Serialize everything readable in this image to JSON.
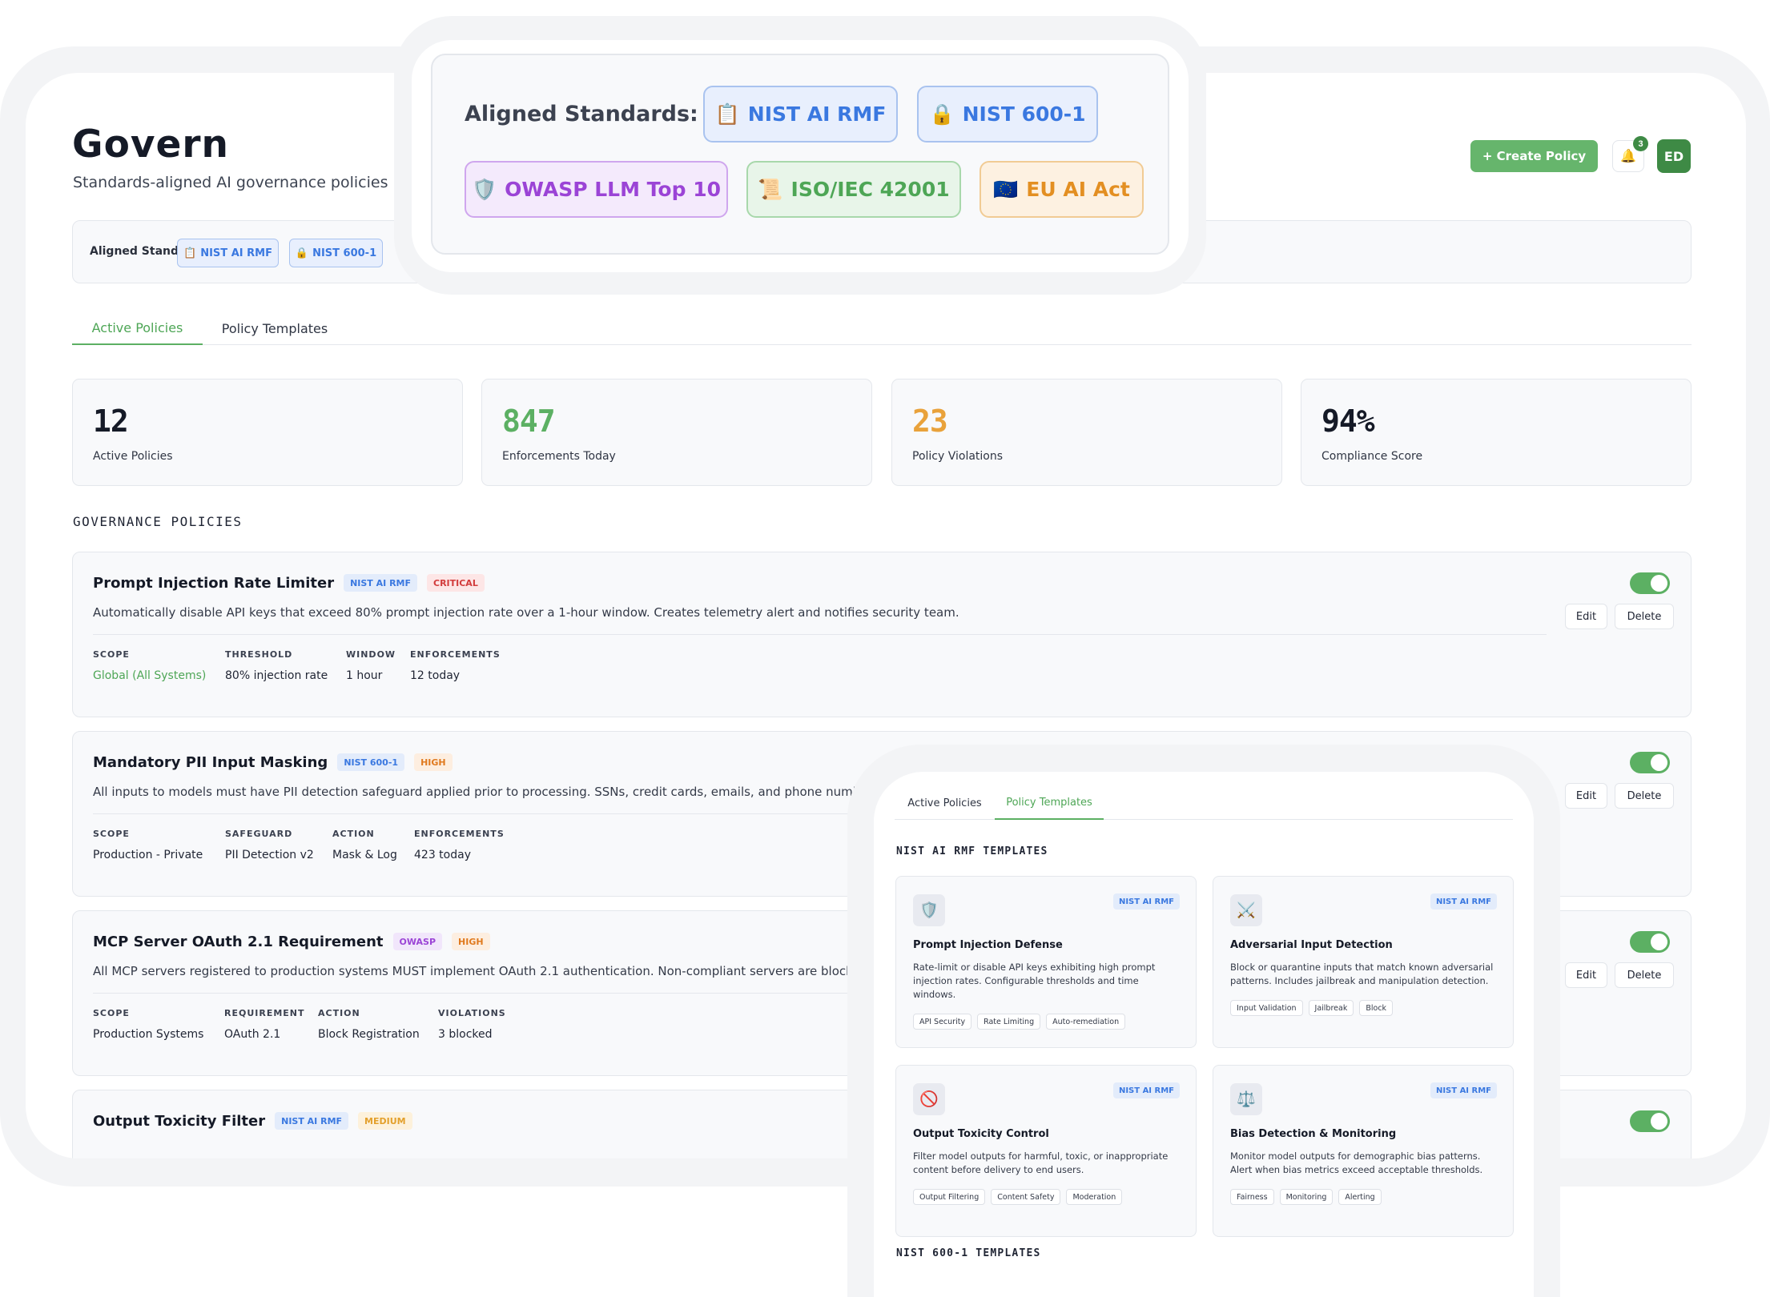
{
  "header": {
    "title": "Govern",
    "subtitle": "Standards-aligned AI governance policies",
    "create_label": "+ Create Policy",
    "notification_count": "3",
    "avatar_initials": "ED"
  },
  "standards": {
    "label": "Aligned Standards:",
    "items": [
      {
        "icon": "📋",
        "label": "NIST AI RMF"
      },
      {
        "icon": "🔒",
        "label": "NIST 600-1"
      },
      {
        "icon": "🛡️",
        "label": "OWASP LLM Top 10"
      },
      {
        "icon": "📜",
        "label": "ISO/IEC 42001"
      },
      {
        "icon": "🇪🇺",
        "label": "EU AI Act"
      }
    ]
  },
  "tabs": [
    {
      "label": "Active Policies",
      "active": true
    },
    {
      "label": "Policy Templates",
      "active": false
    }
  ],
  "stats": [
    {
      "value": "12",
      "label": "Active Policies",
      "color": "#151a27"
    },
    {
      "value": "847",
      "label": "Enforcements Today",
      "color": "#5cb063"
    },
    {
      "value": "23",
      "label": "Policy Violations",
      "color": "#e9a23b"
    },
    {
      "value": "94%",
      "label": "Compliance Score",
      "color": "#151a27"
    }
  ],
  "section_title": "GOVERNANCE POLICIES",
  "policies": [
    {
      "title": "Prompt Injection Rate Limiter",
      "badges": [
        "NIST AI RMF",
        "CRITICAL"
      ],
      "description": "Automatically disable API keys that exceed 80% prompt injection rate over a 1-hour window. Creates telemetry alert and notifies security team.",
      "enabled": true,
      "edit_label": "Edit",
      "delete_label": "Delete",
      "meta": [
        {
          "label": "SCOPE",
          "value": "Global (All Systems)"
        },
        {
          "label": "THRESHOLD",
          "value": "80% injection rate"
        },
        {
          "label": "WINDOW",
          "value": "1 hour"
        },
        {
          "label": "ENFORCEMENTS",
          "value": "12 today"
        }
      ]
    },
    {
      "title": "Mandatory PII Input Masking",
      "badges": [
        "NIST 600-1",
        "HIGH"
      ],
      "description": "All inputs to models must have PII detection safeguard applied prior to processing. SSNs, credit cards, emails, and phone numbers ar",
      "enabled": true,
      "edit_label": "Edit",
      "delete_label": "Delete",
      "meta": [
        {
          "label": "SCOPE",
          "value": "Production - Private"
        },
        {
          "label": "SAFEGUARD",
          "value": "PII Detection v2"
        },
        {
          "label": "ACTION",
          "value": "Mask & Log"
        },
        {
          "label": "ENFORCEMENTS",
          "value": "423 today"
        }
      ]
    },
    {
      "title": "MCP Server OAuth 2.1 Requirement",
      "badges": [
        "OWASP",
        "HIGH"
      ],
      "description": "All MCP servers registered to production systems MUST implement OAuth 2.1 authentication. Non-compliant servers are blocked fror",
      "enabled": true,
      "edit_label": "Edit",
      "delete_label": "Delete",
      "meta": [
        {
          "label": "SCOPE",
          "value": "Production Systems"
        },
        {
          "label": "REQUIREMENT",
          "value": "OAuth 2.1"
        },
        {
          "label": "ACTION",
          "value": "Block Registration"
        },
        {
          "label": "VIOLATIONS",
          "value": "3 blocked"
        }
      ]
    },
    {
      "title": "Output Toxicity Filter",
      "badges": [
        "NIST AI RMF",
        "MEDIUM"
      ],
      "enabled": true
    }
  ],
  "templates_view": {
    "tabs": [
      {
        "label": "Active Policies",
        "active": false
      },
      {
        "label": "Policy Templates",
        "active": true
      }
    ],
    "section_nist_rmf": "NIST AI RMF TEMPLATES",
    "section_nist_600": "NIST 600-1 TEMPLATES",
    "templates": [
      {
        "icon": "🛡️",
        "icon_name": "shield-icon",
        "standard": "NIST AI RMF",
        "title": "Prompt Injection Defense",
        "description": "Rate-limit or disable API keys exhibiting high prompt injection rates. Configurable thresholds and time windows.",
        "tags": [
          "API Security",
          "Rate Limiting",
          "Auto-remediation"
        ]
      },
      {
        "icon": "⚔️",
        "icon_name": "crossed-swords-icon",
        "standard": "NIST AI RMF",
        "title": "Adversarial Input Detection",
        "description": "Block or quarantine inputs that match known adversarial patterns. Includes jailbreak and manipulation detection.",
        "tags": [
          "Input Validation",
          "Jailbreak",
          "Block"
        ]
      },
      {
        "icon": "🚫",
        "icon_name": "prohibited-icon",
        "standard": "NIST AI RMF",
        "title": "Output Toxicity Control",
        "description": "Filter model outputs for harmful, toxic, or inappropriate content before delivery to end users.",
        "tags": [
          "Output Filtering",
          "Content Safety",
          "Moderation"
        ]
      },
      {
        "icon": "⚖️",
        "icon_name": "scales-icon",
        "standard": "NIST AI RMF",
        "title": "Bias Detection & Monitoring",
        "description": "Monitor model outputs for demographic bias patterns. Alert when bias metrics exceed acceptable thresholds.",
        "tags": [
          "Fairness",
          "Monitoring",
          "Alerting"
        ]
      }
    ]
  }
}
